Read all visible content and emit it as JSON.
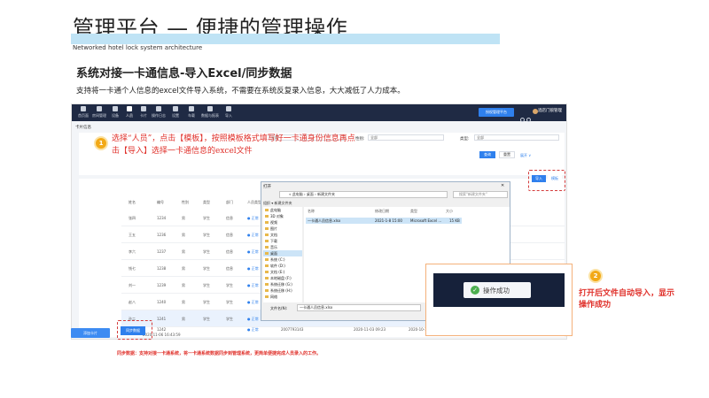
{
  "slide": {
    "title": "管理平台 — 便捷的管理操作",
    "subtitle_en": "Networked hotel lock system architecture",
    "heading": "系统对接一卡通信息-导入Excel/同步数据",
    "desc": "支持将一卡通个人信息的excel文件导入系统，不需要在系统反复录入信息，大大减低了人力成本。",
    "bottom_note": "同步数据：支持对接一卡通系统，将一卡通系统数据同步到管理系统，更简单便捷完成人员录入的工作。"
  },
  "app": {
    "nav_items": [
      "首页面",
      "房间管理",
      "设备",
      "人员",
      "卡片",
      "操作日志",
      "设置",
      "车载",
      "数据与报表",
      "导入"
    ],
    "nav_active_index": 3,
    "top_button": "授权管理平台",
    "user": "酒店门锁管理",
    "breadcrumb": "卡片信息",
    "filters": {
      "gender_label": "性别:",
      "gender_value": "全部",
      "type_label": "类型:",
      "type_value": "全部",
      "name_value": "全部"
    },
    "search_button": "查询",
    "reset_button": "重置",
    "expand_link": "展开 ∨",
    "import_button": "导入",
    "template_button": "模板",
    "sync_button": "同步数据",
    "left_button": "添加卡片",
    "table_headers": [
      "姓名",
      "编号",
      "性别",
      "类型",
      "部门",
      "人员类型"
    ],
    "rows": [
      {
        "name": "张四",
        "code": "1234",
        "gender": "男",
        "type": "学生",
        "dept": "信息",
        "status": "● 正常"
      },
      {
        "name": "王五",
        "code": "1236",
        "gender": "男",
        "type": "学生",
        "dept": "信息",
        "status": "● 正常"
      },
      {
        "name": "李六",
        "code": "1237",
        "gender": "男",
        "type": "学生",
        "dept": "信息",
        "status": "● 正常"
      },
      {
        "name": "钱七",
        "code": "1238",
        "gender": "男",
        "type": "学生",
        "dept": "信息",
        "status": "● 正常"
      },
      {
        "name": "刘一",
        "code": "1239",
        "gender": "男",
        "type": "学生",
        "dept": "学生",
        "status": "● 正常"
      },
      {
        "name": "赵八",
        "code": "1240",
        "gender": "男",
        "type": "学生",
        "dept": "学生",
        "status": "● 正常"
      },
      {
        "name": "孙二",
        "code": "1241",
        "gender": "男",
        "type": "学生",
        "dept": "学生",
        "status": "● 正常"
      }
    ],
    "footer_time": "2020-11-06 16:43:59",
    "last_row": {
      "code": "1242",
      "status": "● 正常",
      "id": "2007793143",
      "date1": "2020-11-03 09:23",
      "date2": "2020-10-16 15"
    }
  },
  "step1": {
    "badge": "1",
    "text": "选择“人员”，点击【模板】，按照模板格式填写好一卡通身份信息再点击【导入】选择一卡通信息的excel文件"
  },
  "dialog": {
    "title": "打开",
    "path": "« 此电脑 › 桌面 › 新建文件夹",
    "search_placeholder": "搜索\"新建文件夹\"",
    "toolbar": "组织 ▾    新建文件夹",
    "sidebar": [
      "此电脑",
      "3D 对象",
      "视频",
      "图片",
      "文档",
      "下载",
      "音乐",
      "桌面",
      "系统 (C:)",
      "软件 (D:)",
      "文档 (E:)",
      "本地磁盘 (F:)",
      "系统迁移 (G:)",
      "系统迁移 (H:)",
      "网络"
    ],
    "sidebar_selected_index": 7,
    "columns": [
      "名称",
      "修改日期",
      "类型",
      "大小"
    ],
    "file": {
      "name": "一卡通人员信息.xlsx",
      "date": "2021-1-8 15:00",
      "type": "Microsoft Excel ...",
      "size": "15 KB"
    },
    "filename_label": "文件名(N):",
    "filename_value": "一卡通人员信息.xlsx",
    "open_button": "打开(O)",
    "cancel_button": "取消"
  },
  "step2": {
    "badge": "2",
    "text": "打开后文件自动导入，显示操作成功",
    "toast": "操作成功"
  },
  "colors": {
    "accent_blue": "#2f80ed",
    "annotation_red": "#e0322c",
    "badge_orange": "#f2a917",
    "nav_dark": "#1f2a44"
  }
}
